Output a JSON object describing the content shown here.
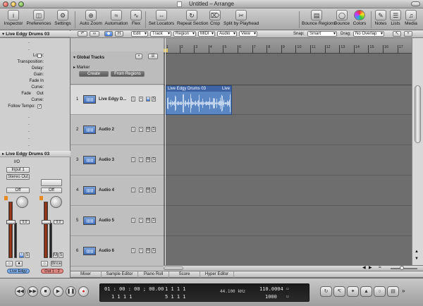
{
  "window": {
    "title": "Untitled – Arrange"
  },
  "toolbar": {
    "items": [
      {
        "label": "Inspector",
        "icon": "info-icon"
      },
      {
        "label": "Preferences",
        "icon": "switch-icon"
      },
      {
        "label": "Settings",
        "icon": "gear-icon"
      },
      {
        "label": "Auto Zoom",
        "icon": "zoom-icon"
      },
      {
        "label": "Automation",
        "icon": "automation-icon"
      },
      {
        "label": "Flex",
        "icon": "flex-icon"
      },
      {
        "label": "Set Locators",
        "icon": "locator-icon"
      },
      {
        "label": "Repeat Section",
        "icon": "repeat-icon"
      },
      {
        "label": "Crop",
        "icon": "crop-icon"
      },
      {
        "label": "Split by Playhead",
        "icon": "split-icon"
      },
      {
        "label": "Bounce Regions",
        "icon": "bounce-regions-icon"
      },
      {
        "label": "Bounce",
        "icon": "bounce-icon"
      },
      {
        "label": "Colors",
        "icon": "colors-icon"
      },
      {
        "label": "Notes",
        "icon": "notes-icon"
      },
      {
        "label": "Lists",
        "icon": "lists-icon"
      },
      {
        "label": "Media",
        "icon": "media-icon"
      }
    ]
  },
  "strip": {
    "buttons": [
      "Edit",
      "Track",
      "Region",
      "MIDI",
      "Audio",
      "View"
    ],
    "snap_label": "Snap:",
    "snap_value": "Smart",
    "drag_label": "Drag:",
    "drag_value": "No Overlap"
  },
  "inspector": {
    "region_title": "Live Edgy Drums 03",
    "params": [
      {
        "label": "",
        "value": "-"
      },
      {
        "label": "",
        "value": "-"
      },
      {
        "label": "Loop:",
        "value": ""
      },
      {
        "label": "Transposition:",
        "value": ""
      },
      {
        "label": "Delay:",
        "value": ""
      },
      {
        "label": "Gain:",
        "value": ""
      },
      {
        "label": "Fade In",
        "value": ""
      },
      {
        "label": "Curve:",
        "value": ""
      },
      {
        "label": "Fade",
        "value": "Out"
      },
      {
        "label": "Curve:",
        "value": ""
      },
      {
        "label": "Follow Tempo:",
        "value": ""
      }
    ],
    "track_title": "Live Edgy Drums 03",
    "io_label": "I/O",
    "input": "Input 1",
    "output": "Stereo Out",
    "off_label": "Off",
    "fader_value": "0.0",
    "mute": "M",
    "solo": "S",
    "bnce": "Bnce",
    "channel_name": "Live Edgy",
    "out_name": "Out 1 - 2"
  },
  "global": {
    "title": "Global Tracks",
    "marker_label": "Marker",
    "create_button": "Create",
    "from_regions_button": "From Regions"
  },
  "tracks": [
    {
      "num": "1",
      "name": "Live Edgy D..."
    },
    {
      "num": "2",
      "name": "Audio 2"
    },
    {
      "num": "3",
      "name": "Audio 3"
    },
    {
      "num": "4",
      "name": "Audio 4"
    },
    {
      "num": "5",
      "name": "Audio 5"
    },
    {
      "num": "6",
      "name": "Audio 6"
    }
  ],
  "ruler": {
    "bars": [
      "1",
      "2",
      "3",
      "4",
      "5",
      "6",
      "7",
      "8",
      "9",
      "10",
      "11",
      "12",
      "13",
      "14",
      "15",
      "16",
      "17"
    ]
  },
  "region": {
    "name": "Live Edgy Drums 03",
    "loop_label": "Live"
  },
  "tabs": [
    "Mixer",
    "Sample Editor",
    "Piano Roll",
    "Score",
    "Hyper Editor"
  ],
  "transport": {
    "smpte": "01 : 00 : 00 ; 00.00",
    "bars": "1   1   1   1",
    "bars2": "1   1   1   1",
    "locator_start": "1   1   1   1",
    "locator_end": "5   1   1   1",
    "sample_rate": "44.100 kHz",
    "tempo": "110.0004",
    "division": "1000"
  }
}
